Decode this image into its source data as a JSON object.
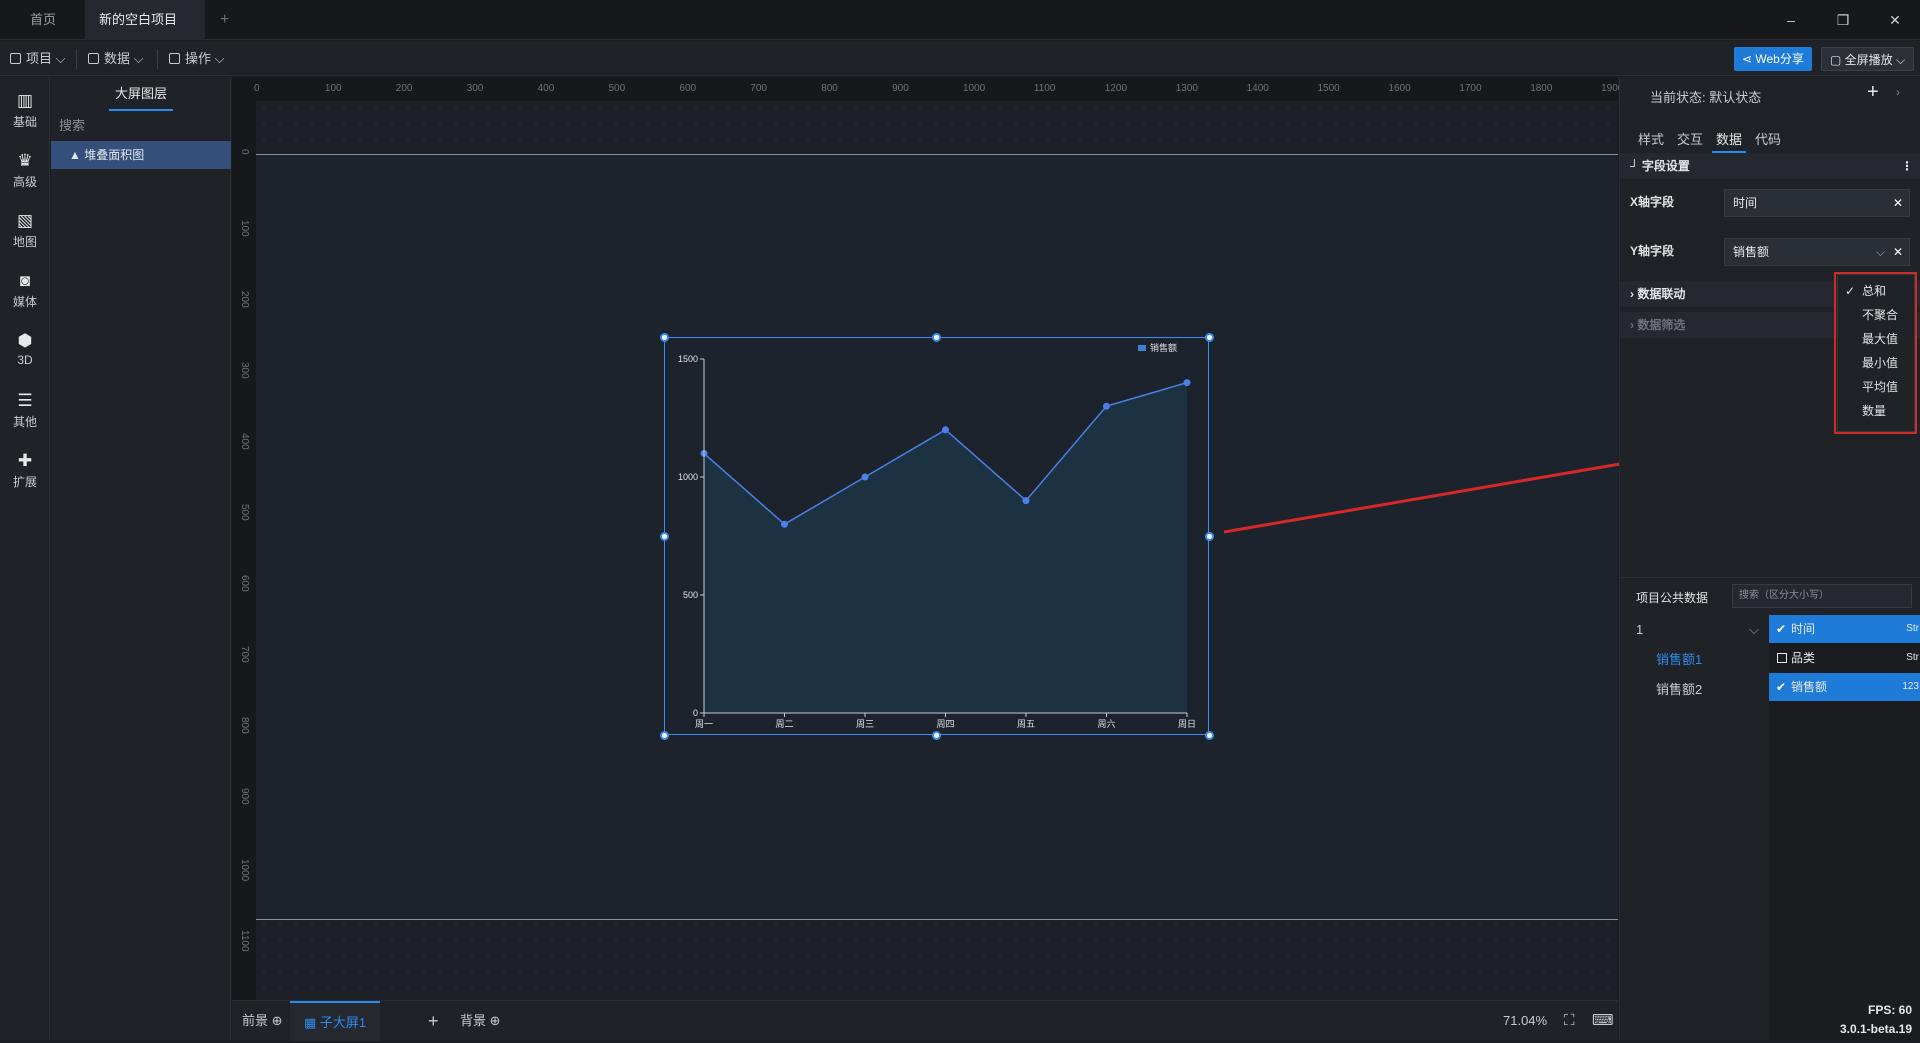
{
  "tabs": {
    "home": "首页",
    "project": "新的空白项目"
  },
  "window": {
    "minimize": "–",
    "restore": "❐",
    "close": "✕"
  },
  "toolbar": {
    "project": "项目",
    "data": "数据",
    "operate": "操作",
    "web_share": "Web分享",
    "fullscreen": "全屏播放"
  },
  "rail": [
    "基础",
    "高级",
    "地图",
    "媒体",
    "3D",
    "其他",
    "扩展"
  ],
  "layers": {
    "title": "大屏图层",
    "search": "搜索",
    "item": "堆叠面积图"
  },
  "ruler": {
    "h": [
      "0",
      "100",
      "200",
      "300",
      "400",
      "500",
      "600",
      "700",
      "800",
      "900",
      "1000",
      "1100",
      "1200",
      "1300",
      "1400",
      "1500",
      "1600",
      "1700",
      "1800",
      "1900"
    ],
    "v": [
      "0",
      "100",
      "200",
      "300",
      "400",
      "500",
      "600",
      "700",
      "800",
      "900",
      "1000",
      "1100"
    ]
  },
  "chart_data": {
    "type": "area",
    "categories": [
      "周一",
      "周二",
      "周三",
      "周四",
      "周五",
      "周六",
      "周日"
    ],
    "series": [
      {
        "name": "销售额",
        "values": [
          1100,
          800,
          1000,
          1200,
          900,
          1300,
          1400
        ]
      }
    ],
    "ylim": [
      0,
      1500
    ],
    "yticks": [
      "0",
      "500",
      "1000",
      "1500"
    ],
    "legend": "top-right",
    "colors": {
      "line": "#4a80e8",
      "fill": "#1c3446",
      "axis": "#c8ccd2"
    }
  },
  "bottom": {
    "front": "前景",
    "sub": "子大屏1",
    "background": "背景",
    "zoom": "71.04%"
  },
  "right": {
    "status_label": "当前状态:",
    "status_value": "默认状态",
    "tabs": [
      "样式",
      "交互",
      "数据",
      "代码"
    ],
    "field_settings": "字段设置",
    "x_label": "X轴字段",
    "x_value": "时间",
    "y_label": "Y轴字段",
    "y_value": "销售额",
    "data_link": "数据联动",
    "data_filter": "数据筛选",
    "agg_options": [
      "总和",
      "不聚合",
      "最大值",
      "最小值",
      "平均值",
      "数量"
    ],
    "public_data": "项目公共数据",
    "public_search": "搜索（区分大小写）",
    "dataset": "1",
    "datasets": [
      "销售额1",
      "销售额2"
    ],
    "columns": [
      {
        "name": "时间",
        "type": "Str",
        "checked": true
      },
      {
        "name": "品类",
        "type": "Str",
        "checked": false
      },
      {
        "name": "销售额",
        "type": "123",
        "checked": true
      }
    ],
    "fps": "FPS: 60",
    "version": "3.0.1-beta.19"
  }
}
